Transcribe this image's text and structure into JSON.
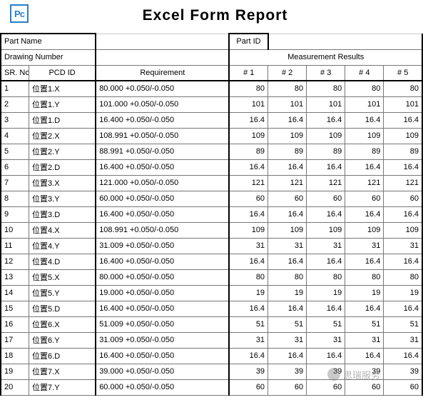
{
  "logo_text": "Pc",
  "title": "Excel  Form  Report",
  "header": {
    "part_name_label": "Part Name",
    "part_id_label": "Part ID",
    "drawing_number_label": "Drawing Number",
    "measurement_results_label": "Measurement Results",
    "sr_no_label": "SR. No",
    "pcd_id_label": "PCD ID",
    "requirement_label": "Requirement",
    "m_labels": [
      "# 1",
      "# 2",
      "# 3",
      "# 4",
      "# 5"
    ]
  },
  "rows": [
    {
      "sr": "1",
      "pcd": "位置1.X",
      "req": "80.000  +0.050/-0.050",
      "m": [
        "80",
        "80",
        "80",
        "80",
        "80"
      ]
    },
    {
      "sr": "2",
      "pcd": "位置1.Y",
      "req": "101.000  +0.050/-0.050",
      "m": [
        "101",
        "101",
        "101",
        "101",
        "101"
      ]
    },
    {
      "sr": "3",
      "pcd": "位置1.D",
      "req": "16.400  +0.050/-0.050",
      "m": [
        "16.4",
        "16.4",
        "16.4",
        "16.4",
        "16.4"
      ]
    },
    {
      "sr": "4",
      "pcd": "位置2.X",
      "req": "108.991  +0.050/-0.050",
      "m": [
        "109",
        "109",
        "109",
        "109",
        "109"
      ]
    },
    {
      "sr": "5",
      "pcd": "位置2.Y",
      "req": "88.991  +0.050/-0.050",
      "m": [
        "89",
        "89",
        "89",
        "89",
        "89"
      ]
    },
    {
      "sr": "6",
      "pcd": "位置2.D",
      "req": "16.400  +0.050/-0.050",
      "m": [
        "16.4",
        "16.4",
        "16.4",
        "16.4",
        "16.4"
      ]
    },
    {
      "sr": "7",
      "pcd": "位置3.X",
      "req": "121.000  +0.050/-0.050",
      "m": [
        "121",
        "121",
        "121",
        "121",
        "121"
      ]
    },
    {
      "sr": "8",
      "pcd": "位置3.Y",
      "req": "60.000  +0.050/-0.050",
      "m": [
        "60",
        "60",
        "60",
        "60",
        "60"
      ]
    },
    {
      "sr": "9",
      "pcd": "位置3.D",
      "req": "16.400  +0.050/-0.050",
      "m": [
        "16.4",
        "16.4",
        "16.4",
        "16.4",
        "16.4"
      ]
    },
    {
      "sr": "10",
      "pcd": "位置4.X",
      "req": "108.991  +0.050/-0.050",
      "m": [
        "109",
        "109",
        "109",
        "109",
        "109"
      ]
    },
    {
      "sr": "11",
      "pcd": "位置4.Y",
      "req": "31.009  +0.050/-0.050",
      "m": [
        "31",
        "31",
        "31",
        "31",
        "31"
      ]
    },
    {
      "sr": "12",
      "pcd": "位置4.D",
      "req": "16.400  +0.050/-0.050",
      "m": [
        "16.4",
        "16.4",
        "16.4",
        "16.4",
        "16.4"
      ]
    },
    {
      "sr": "13",
      "pcd": "位置5.X",
      "req": "80.000  +0.050/-0.050",
      "m": [
        "80",
        "80",
        "80",
        "80",
        "80"
      ]
    },
    {
      "sr": "14",
      "pcd": "位置5.Y",
      "req": "19.000  +0.050/-0.050",
      "m": [
        "19",
        "19",
        "19",
        "19",
        "19"
      ]
    },
    {
      "sr": "15",
      "pcd": "位置5.D",
      "req": "16.400  +0.050/-0.050",
      "m": [
        "16.4",
        "16.4",
        "16.4",
        "16.4",
        "16.4"
      ]
    },
    {
      "sr": "16",
      "pcd": "位置6.X",
      "req": "51.009  +0.050/-0.050",
      "m": [
        "51",
        "51",
        "51",
        "51",
        "51"
      ]
    },
    {
      "sr": "17",
      "pcd": "位置6.Y",
      "req": "31.009  +0.050/-0.050",
      "m": [
        "31",
        "31",
        "31",
        "31",
        "31"
      ]
    },
    {
      "sr": "18",
      "pcd": "位置6.D",
      "req": "16.400  +0.050/-0.050",
      "m": [
        "16.4",
        "16.4",
        "16.4",
        "16.4",
        "16.4"
      ]
    },
    {
      "sr": "19",
      "pcd": "位置7.X",
      "req": "39.000  +0.050/-0.050",
      "m": [
        "39",
        "39",
        "39",
        "39",
        "39"
      ]
    },
    {
      "sr": "20",
      "pcd": "位置7.Y",
      "req": "60.000  +0.050/-0.050",
      "m": [
        "60",
        "60",
        "60",
        "60",
        "60"
      ]
    }
  ],
  "watermark": "思瑞服务"
}
